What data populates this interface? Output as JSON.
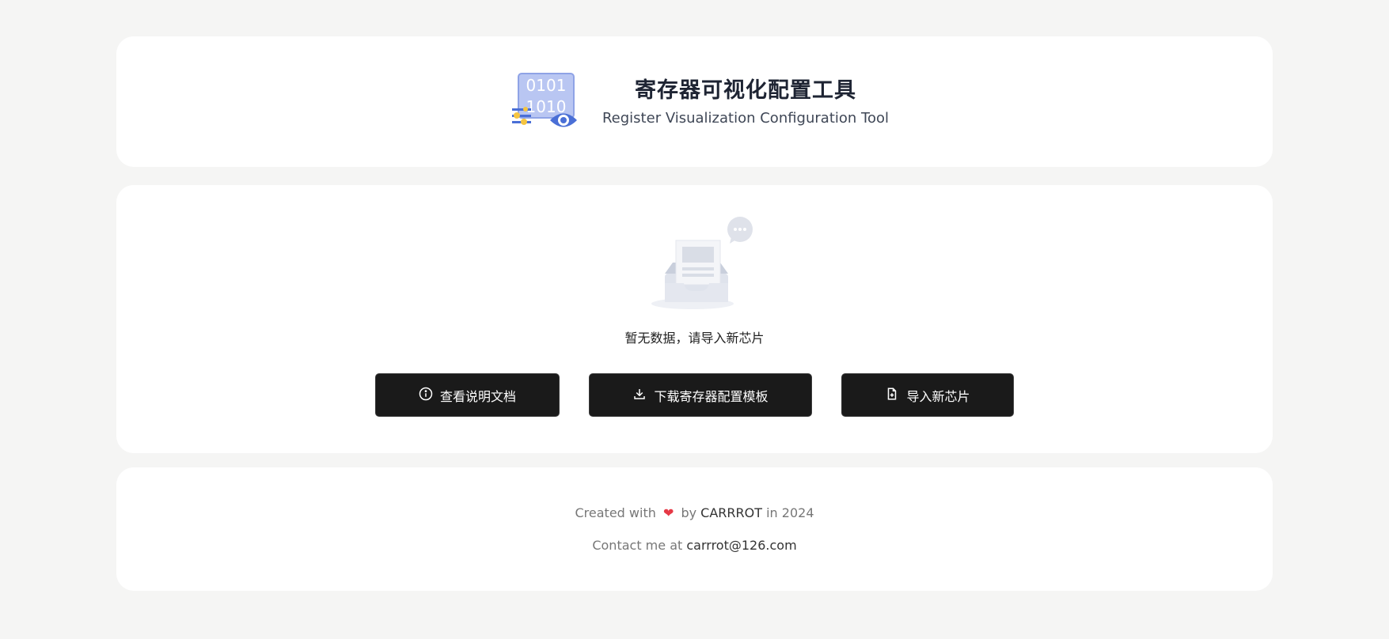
{
  "header": {
    "title": "寄存器可视化配置工具",
    "subtitle": "Register Visualization Configuration Tool",
    "logo_text_top": "0101",
    "logo_text_bottom": "1010"
  },
  "main": {
    "empty_message": "暂无数据，请导入新芯片",
    "buttons": {
      "docs_label": "查看说明文档",
      "download_label": "下载寄存器配置模板",
      "import_label": "导入新芯片"
    }
  },
  "footer": {
    "created_prefix": "Created with",
    "heart": "❤",
    "created_by": "by",
    "author": "CARRROT",
    "created_suffix": "in 2024",
    "contact_prefix": "Contact me at",
    "email": "carrrot@126.com"
  },
  "colors": {
    "background": "#f5f5f4",
    "card": "#ffffff",
    "button": "#1a1a1a",
    "accent_blue": "#4a6fd6",
    "heart": "#e63946"
  },
  "icons": {
    "logo": "binary-eye-logo-icon",
    "empty": "empty-inbox-icon",
    "docs": "info-circle-icon",
    "download": "download-icon",
    "import": "file-plus-icon"
  }
}
